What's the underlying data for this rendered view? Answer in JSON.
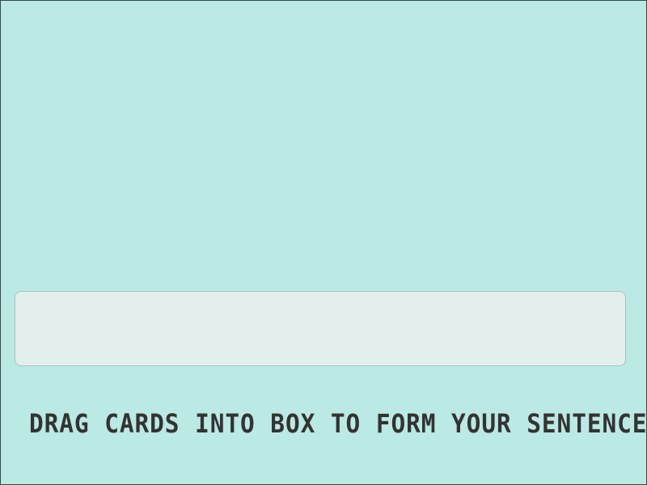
{
  "game": {
    "instruction": "DRAG CARDS INTO BOX TO FORM YOUR SENTENCE",
    "colors": {
      "background": "#bbe9e3",
      "drop_box_fill": "#e3efed",
      "drop_box_border": "#a9c2be",
      "text": "#333333"
    }
  }
}
